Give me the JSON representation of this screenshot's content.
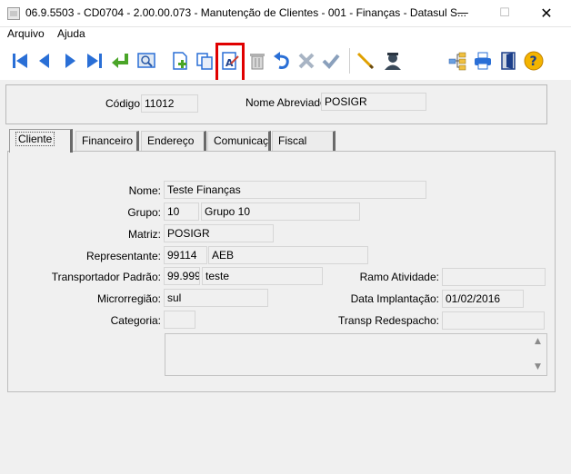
{
  "window": {
    "title": "06.9.5503 - CD0704 - 2.00.00.073 - Manutenção de Clientes - 001 - Finanças - Datasul S...",
    "minimize": "—",
    "maximize": "☐",
    "close": "✕"
  },
  "menu": {
    "items": [
      {
        "label": "Arquivo"
      },
      {
        "label": "Ajuda"
      }
    ]
  },
  "toolbar": {
    "buttons": [
      "first-record-icon",
      "prev-record-icon",
      "next-record-icon",
      "last-record-icon",
      "goto-icon",
      "search-icon",
      "new-record-icon",
      "copy-record-icon",
      "edit-record-icon",
      "delete-record-icon",
      "undo-icon",
      "cancel-icon",
      "save-icon",
      "query-icon",
      "user-icon",
      "tree-icon",
      "print-icon",
      "exit-icon",
      "help-icon"
    ],
    "highlighted": "edit-record-icon",
    "highlight_color": "#e00000"
  },
  "header": {
    "codigo_label": "Código:",
    "codigo_value": "11012",
    "nome_abreviado_label": "Nome Abreviado:",
    "nome_abreviado_value": "POSIGR"
  },
  "tabs": [
    {
      "label": "Cliente",
      "active": true
    },
    {
      "label": "Financeiro",
      "active": false
    },
    {
      "label": "Endereço",
      "active": false
    },
    {
      "label": "Comunicaç",
      "active": false
    },
    {
      "label": "Fiscal",
      "active": false
    }
  ],
  "form": {
    "nome_label": "Nome:",
    "nome_value": "Teste Finanças",
    "grupo_label": "Grupo:",
    "grupo_code": "10",
    "grupo_desc": "Grupo 10",
    "matriz_label": "Matriz:",
    "matriz_value": "POSIGR",
    "representante_label": "Representante:",
    "representante_code": "99114",
    "representante_name": "AEB",
    "transportador_label": "Transportador Padrão:",
    "transportador_code": "99.999",
    "transportador_name": "teste",
    "ramo_label": "Ramo Atividade:",
    "ramo_value": "",
    "microrregiao_label": "Microrregião:",
    "microrregiao_value": "sul",
    "data_implantacao_label": "Data Implantação:",
    "data_implantacao_value": "01/02/2016",
    "categoria_label": "Categoria:",
    "categoria_value": "",
    "transp_redespacho_label": "Transp Redespacho:",
    "transp_redespacho_value": "",
    "observacao_value": ""
  }
}
